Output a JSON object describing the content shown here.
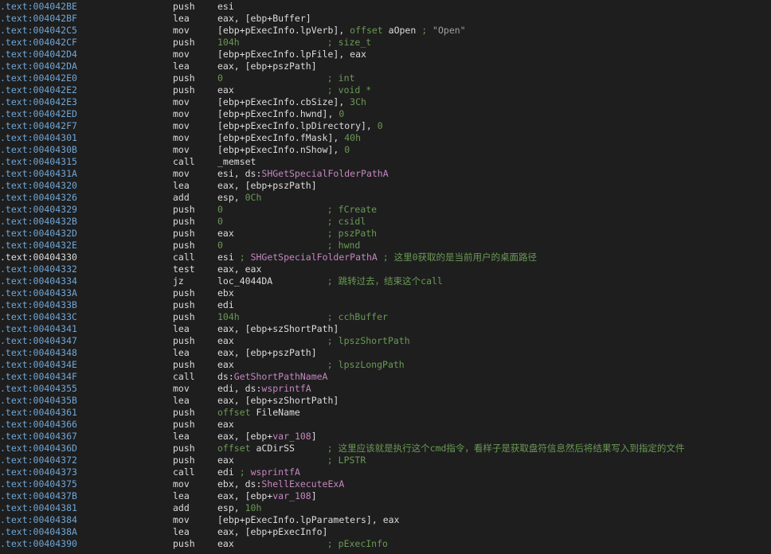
{
  "colors": {
    "background": "#1e1e1e",
    "address": "#6fa6d6",
    "text": "#dcdcdc",
    "number_comment": "#6a9955",
    "import_name": "#c586c0",
    "string": "#a0a0a0"
  },
  "lines": [
    {
      "addr": ".text:004042BE",
      "mn": "push",
      "ops": [
        {
          "t": "t",
          "v": "esi"
        }
      ]
    },
    {
      "addr": ".text:004042BF",
      "mn": "lea",
      "ops": [
        {
          "t": "t",
          "v": "eax, [ebp+Buffer]"
        }
      ]
    },
    {
      "addr": ".text:004042C5",
      "mn": "mov",
      "ops": [
        {
          "t": "t",
          "v": "[ebp+pExecInfo.lpVerb], "
        },
        {
          "t": "n",
          "v": "offset"
        },
        {
          "t": "t",
          "v": " aOpen "
        },
        {
          "t": "c",
          "v": "; "
        },
        {
          "t": "s",
          "v": "\"Open\""
        }
      ]
    },
    {
      "addr": ".text:004042CF",
      "mn": "push",
      "ops": [
        {
          "t": "n",
          "v": "104h"
        }
      ],
      "cmt": "; size_t",
      "cmt_col": 42
    },
    {
      "addr": ".text:004042D4",
      "mn": "mov",
      "ops": [
        {
          "t": "t",
          "v": "[ebp+pExecInfo.lpFile], eax"
        }
      ]
    },
    {
      "addr": ".text:004042DA",
      "mn": "lea",
      "ops": [
        {
          "t": "t",
          "v": "eax, [ebp+pszPath]"
        }
      ]
    },
    {
      "addr": ".text:004042E0",
      "mn": "push",
      "ops": [
        {
          "t": "n",
          "v": "0"
        }
      ],
      "cmt": "; int",
      "cmt_col": 42
    },
    {
      "addr": ".text:004042E2",
      "mn": "push",
      "ops": [
        {
          "t": "t",
          "v": "eax"
        }
      ],
      "cmt": "; void *",
      "cmt_col": 42
    },
    {
      "addr": ".text:004042E3",
      "mn": "mov",
      "ops": [
        {
          "t": "t",
          "v": "[ebp+pExecInfo.cbSize], "
        },
        {
          "t": "n",
          "v": "3Ch"
        }
      ]
    },
    {
      "addr": ".text:004042ED",
      "mn": "mov",
      "ops": [
        {
          "t": "t",
          "v": "[ebp+pExecInfo.hwnd], "
        },
        {
          "t": "n",
          "v": "0"
        }
      ]
    },
    {
      "addr": ".text:004042F7",
      "mn": "mov",
      "ops": [
        {
          "t": "t",
          "v": "[ebp+pExecInfo.lpDirectory], "
        },
        {
          "t": "n",
          "v": "0"
        }
      ]
    },
    {
      "addr": ".text:00404301",
      "mn": "mov",
      "ops": [
        {
          "t": "t",
          "v": "[ebp+pExecInfo.fMask], "
        },
        {
          "t": "n",
          "v": "40h"
        }
      ]
    },
    {
      "addr": ".text:0040430B",
      "mn": "mov",
      "ops": [
        {
          "t": "t",
          "v": "[ebp+pExecInfo.nShow], "
        },
        {
          "t": "n",
          "v": "0"
        }
      ]
    },
    {
      "addr": ".text:00404315",
      "mn": "call",
      "ops": [
        {
          "t": "t",
          "v": "_memset"
        }
      ]
    },
    {
      "addr": ".text:0040431A",
      "mn": "mov",
      "ops": [
        {
          "t": "t",
          "v": "esi, ds:"
        },
        {
          "t": "p",
          "v": "SHGetSpecialFolderPathA"
        }
      ]
    },
    {
      "addr": ".text:00404320",
      "mn": "lea",
      "ops": [
        {
          "t": "t",
          "v": "eax, [ebp+pszPath]"
        }
      ]
    },
    {
      "addr": ".text:00404326",
      "mn": "add",
      "ops": [
        {
          "t": "t",
          "v": "esp, "
        },
        {
          "t": "n",
          "v": "0Ch"
        }
      ]
    },
    {
      "addr": ".text:00404329",
      "mn": "push",
      "ops": [
        {
          "t": "n",
          "v": "0"
        }
      ],
      "cmt": "; fCreate",
      "cmt_col": 42
    },
    {
      "addr": ".text:0040432B",
      "mn": "push",
      "ops": [
        {
          "t": "n",
          "v": "0"
        }
      ],
      "cmt": "; csidl",
      "cmt_col": 42
    },
    {
      "addr": ".text:0040432D",
      "mn": "push",
      "ops": [
        {
          "t": "t",
          "v": "eax"
        }
      ],
      "cmt": "; pszPath",
      "cmt_col": 42
    },
    {
      "addr": ".text:0040432E",
      "mn": "push",
      "ops": [
        {
          "t": "n",
          "v": "0"
        }
      ],
      "cmt": "; hwnd",
      "cmt_col": 42
    },
    {
      "addr": ".text:00404330",
      "hl": true,
      "mn": "call",
      "ops": [
        {
          "t": "t",
          "v": "esi "
        },
        {
          "t": "c",
          "v": "; "
        },
        {
          "t": "p",
          "v": "SHGetSpecialFolderPathA"
        },
        {
          "t": "c",
          "v": " ; 这里0获取的是当前用户的桌面路径"
        }
      ]
    },
    {
      "addr": ".text:00404332",
      "mn": "test",
      "ops": [
        {
          "t": "t",
          "v": "eax, eax"
        }
      ]
    },
    {
      "addr": ".text:00404334",
      "mn": "jz",
      "ops": [
        {
          "t": "t",
          "v": "loc_4044DA"
        }
      ],
      "cmt": "; 跳转过去，结束这个call",
      "cmt_col": 42
    },
    {
      "addr": ".text:0040433A",
      "mn": "push",
      "ops": [
        {
          "t": "t",
          "v": "ebx"
        }
      ]
    },
    {
      "addr": ".text:0040433B",
      "mn": "push",
      "ops": [
        {
          "t": "t",
          "v": "edi"
        }
      ]
    },
    {
      "addr": ".text:0040433C",
      "mn": "push",
      "ops": [
        {
          "t": "n",
          "v": "104h"
        }
      ],
      "cmt": "; cchBuffer",
      "cmt_col": 42
    },
    {
      "addr": ".text:00404341",
      "mn": "lea",
      "ops": [
        {
          "t": "t",
          "v": "eax, [ebp+szShortPath]"
        }
      ]
    },
    {
      "addr": ".text:00404347",
      "mn": "push",
      "ops": [
        {
          "t": "t",
          "v": "eax"
        }
      ],
      "cmt": "; lpszShortPath",
      "cmt_col": 42
    },
    {
      "addr": ".text:00404348",
      "mn": "lea",
      "ops": [
        {
          "t": "t",
          "v": "eax, [ebp+pszPath]"
        }
      ]
    },
    {
      "addr": ".text:0040434E",
      "mn": "push",
      "ops": [
        {
          "t": "t",
          "v": "eax"
        }
      ],
      "cmt": "; lpszLongPath",
      "cmt_col": 42
    },
    {
      "addr": ".text:0040434F",
      "mn": "call",
      "ops": [
        {
          "t": "t",
          "v": "ds:"
        },
        {
          "t": "p",
          "v": "GetShortPathNameA"
        }
      ]
    },
    {
      "addr": ".text:00404355",
      "mn": "mov",
      "ops": [
        {
          "t": "t",
          "v": "edi, ds:"
        },
        {
          "t": "p",
          "v": "wsprintfA"
        }
      ]
    },
    {
      "addr": ".text:0040435B",
      "mn": "lea",
      "ops": [
        {
          "t": "t",
          "v": "eax, [ebp+szShortPath]"
        }
      ]
    },
    {
      "addr": ".text:00404361",
      "mn": "push",
      "ops": [
        {
          "t": "n",
          "v": "offset"
        },
        {
          "t": "t",
          "v": " FileName"
        }
      ]
    },
    {
      "addr": ".text:00404366",
      "mn": "push",
      "ops": [
        {
          "t": "t",
          "v": "eax"
        }
      ]
    },
    {
      "addr": ".text:00404367",
      "mn": "lea",
      "ops": [
        {
          "t": "t",
          "v": "eax, [ebp+"
        },
        {
          "t": "p",
          "v": "var_108"
        },
        {
          "t": "t",
          "v": "]"
        }
      ]
    },
    {
      "addr": ".text:0040436D",
      "mn": "push",
      "ops": [
        {
          "t": "n",
          "v": "offset"
        },
        {
          "t": "t",
          "v": " aCDirSS"
        }
      ],
      "cmt": "; 这里应该就是执行这个cmd指令，看样子是获取盘符信息然后将结果写入到指定的文件",
      "cmt_col": 42
    },
    {
      "addr": ".text:00404372",
      "mn": "push",
      "ops": [
        {
          "t": "t",
          "v": "eax"
        }
      ],
      "cmt": "; LPSTR",
      "cmt_col": 42
    },
    {
      "addr": ".text:00404373",
      "mn": "call",
      "ops": [
        {
          "t": "t",
          "v": "edi "
        },
        {
          "t": "c",
          "v": "; "
        },
        {
          "t": "p",
          "v": "wsprintfA"
        }
      ]
    },
    {
      "addr": ".text:00404375",
      "mn": "mov",
      "ops": [
        {
          "t": "t",
          "v": "ebx, ds:"
        },
        {
          "t": "p",
          "v": "ShellExecuteExA"
        }
      ]
    },
    {
      "addr": ".text:0040437B",
      "mn": "lea",
      "ops": [
        {
          "t": "t",
          "v": "eax, [ebp+"
        },
        {
          "t": "p",
          "v": "var_108"
        },
        {
          "t": "t",
          "v": "]"
        }
      ]
    },
    {
      "addr": ".text:00404381",
      "mn": "add",
      "ops": [
        {
          "t": "t",
          "v": "esp, "
        },
        {
          "t": "n",
          "v": "10h"
        }
      ]
    },
    {
      "addr": ".text:00404384",
      "mn": "mov",
      "ops": [
        {
          "t": "t",
          "v": "[ebp+pExecInfo.lpParameters], eax"
        }
      ]
    },
    {
      "addr": ".text:0040438A",
      "mn": "lea",
      "ops": [
        {
          "t": "t",
          "v": "eax, [ebp+pExecInfo]"
        }
      ]
    },
    {
      "addr": ".text:00404390",
      "mn": "push",
      "ops": [
        {
          "t": "t",
          "v": "eax"
        }
      ],
      "cmt": "; pExecInfo",
      "cmt_col": 42
    }
  ]
}
